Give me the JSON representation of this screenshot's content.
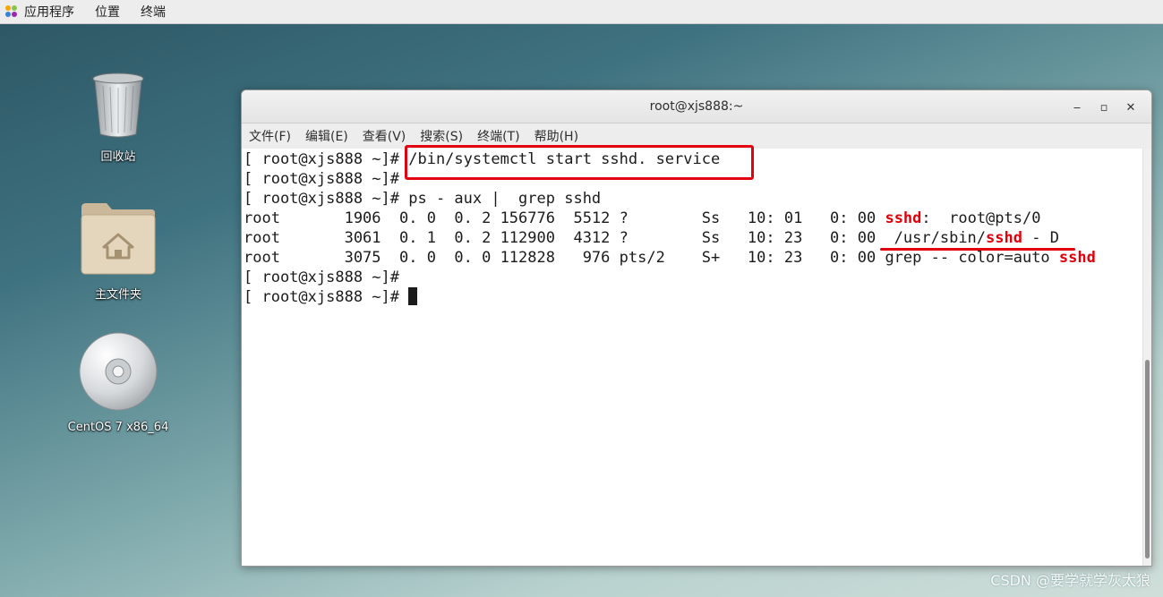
{
  "topbar": {
    "applications": "应用程序",
    "places": "位置",
    "terminal": "终端"
  },
  "desktop": {
    "icons": [
      {
        "label": "回收站",
        "icon": "trash-icon"
      },
      {
        "label": "主文件夹",
        "icon": "home-folder-icon"
      },
      {
        "label": "CentOS 7 x86_64",
        "icon": "disc-icon"
      }
    ]
  },
  "window": {
    "title": "root@xjs888:~",
    "controls": {
      "minimize": "‒",
      "maximize": "▫",
      "close": "✕"
    },
    "menu": [
      "文件(F)",
      "编辑(E)",
      "查看(V)",
      "搜索(S)",
      "终端(T)",
      "帮助(H)"
    ]
  },
  "terminal": {
    "prompt": "[ root@xjs888 ~]# ",
    "lines": {
      "l1_cmd": "/bin/systemctl start sshd. service",
      "l2_cmd": "",
      "l3_cmd": "ps - aux |  grep sshd",
      "r1_pre": "root       1906  0. 0  0. 2 156776  5512 ?        Ss   10: 01   0: 00 ",
      "r1_hl": "sshd",
      "r1_post": ":  root@pts/0",
      "r2_pre": "root       3061  0. 1  0. 2 112900  4312 ?        Ss   10: 23   0: 00  /usr/sbin/",
      "r2_hl": "sshd",
      "r2_post": " - D",
      "r3_pre": "root       3075  0. 0  0. 0 112828   976 pts/2    S+   10: 23   0: 00 grep -- color=auto ",
      "r3_hl": "sshd",
      "l7_cmd": "",
      "l8_cmd": ""
    }
  },
  "watermark": "CSDN @要学就学灰太狼",
  "colors": {
    "highlight": "#e2000a",
    "annotation": "#e3000f"
  }
}
